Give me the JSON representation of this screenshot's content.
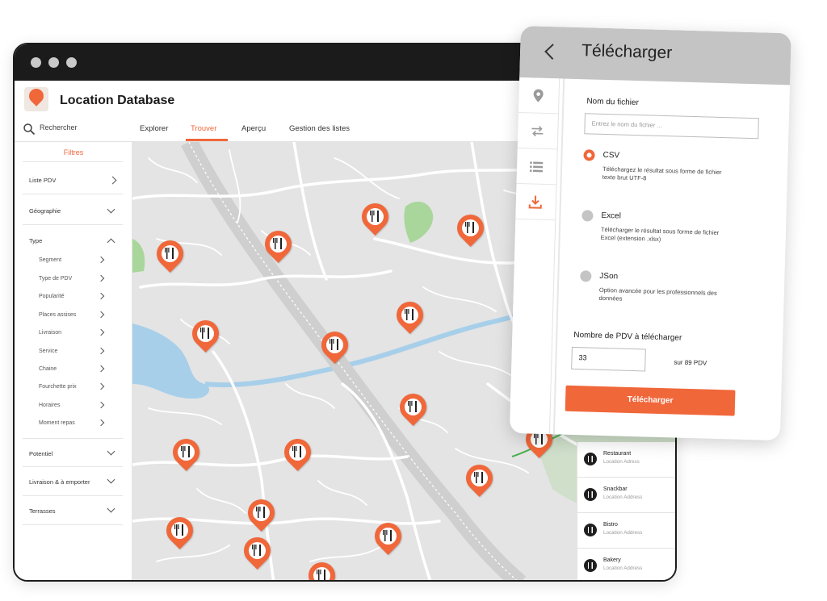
{
  "app": {
    "title": "Location Database"
  },
  "search": {
    "label": "Rechercher"
  },
  "tabs": [
    {
      "label": "Explorer"
    },
    {
      "label": "Trouver"
    },
    {
      "label": "Aperçu"
    },
    {
      "label": "Gestion des listes"
    }
  ],
  "active_tab": "Trouver",
  "sidebar": {
    "title": "Filtres",
    "items": [
      {
        "label": "Liste PDV"
      },
      {
        "label": "Géographie"
      },
      {
        "label": "Type"
      },
      {
        "label": "Potentiel"
      },
      {
        "label": "Livraison & à emporter"
      },
      {
        "label": "Terrasses"
      }
    ],
    "type_subitems": [
      {
        "label": "Segment"
      },
      {
        "label": "Type de PDV"
      },
      {
        "label": "Popularité"
      },
      {
        "label": "Places assises"
      },
      {
        "label": "Livraison"
      },
      {
        "label": "Service"
      },
      {
        "label": "Chaine"
      },
      {
        "label": "Fourchette prix"
      },
      {
        "label": "Horaires"
      },
      {
        "label": "Moment repas"
      }
    ]
  },
  "locations": [
    {
      "name": "Restaurant",
      "address": "Location Adress"
    },
    {
      "name": "Snackbar",
      "address": "Location Address"
    },
    {
      "name": "Bistro",
      "address": "Location Address"
    },
    {
      "name": "Bakery",
      "address": "Location Address"
    }
  ],
  "download_panel": {
    "title": "Télécharger",
    "filename_label": "Nom du fichier",
    "filename_placeholder": "Entrez le nom du fichier ...",
    "formats": [
      {
        "name": "CSV",
        "description": "Téléchargez le résultat sous forme de fichier texte brut UTF-8",
        "selected": true
      },
      {
        "name": "Excel",
        "description": "Télécharger le résultat sous forme de fichier Excel (extension .xlsx)",
        "selected": false
      },
      {
        "name": "JSon",
        "description": "Option avancée pour les professionnels des données",
        "selected": false
      }
    ],
    "count_label": "Nombre de PDV à télécharger",
    "count_value": "33",
    "count_total": "sur 89 PDV",
    "button_label": "Télécharger"
  },
  "colors": {
    "accent": "#f0673a",
    "titlebar": "#1b1b1b",
    "map_background": "#e4e4e4",
    "water": "#a7cfea",
    "park": "#a9d69a"
  },
  "icons": {
    "search": "search-icon",
    "pin": "restaurant-pin-icon",
    "back": "chevron-left-icon",
    "rail": [
      "location-icon",
      "swap-icon",
      "list-icon",
      "download-icon"
    ]
  }
}
